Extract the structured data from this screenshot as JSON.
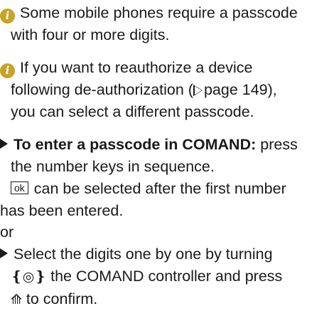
{
  "note1": {
    "icon": "info-icon",
    "line1": "Some mobile phones require a passcode",
    "line2": "with four or more digits."
  },
  "note2": {
    "icon": "info-icon",
    "line1": "If you want to reauthorize a device",
    "line2_before": "following de-authorization (",
    "page_ref": "page 149",
    "line2_after": "),",
    "line3": "you can select a different passcode."
  },
  "step1": {
    "bold_text": "To enter a passcode in COMAND:",
    "line1_rest": " press",
    "line2": "the number keys in sequence.",
    "ok_key": "ok",
    "line3_rest": "can be selected after the first number",
    "line4": "has been entered."
  },
  "or_label": "or",
  "step2": {
    "line1": "Select the digits one by one by turning",
    "controller_left": "❴",
    "controller_mid": "◎",
    "controller_right": "❵",
    "line2_rest": " the COMAND controller and press",
    "press_icon": "⟰",
    "line3_rest": " to confirm."
  }
}
